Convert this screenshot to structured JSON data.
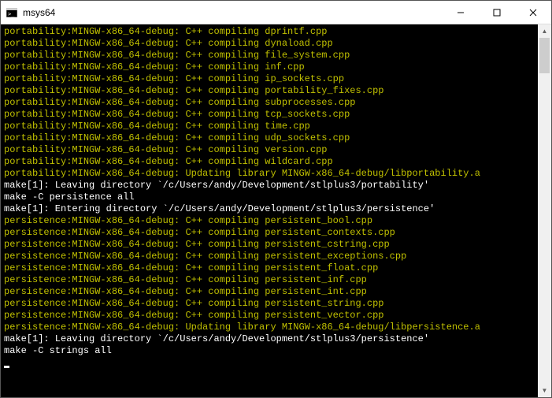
{
  "window": {
    "title": "msys64"
  },
  "lines": [
    {
      "color": "yellow",
      "text": "portability:MINGW-x86_64-debug: C++ compiling dprintf.cpp"
    },
    {
      "color": "yellow",
      "text": "portability:MINGW-x86_64-debug: C++ compiling dynaload.cpp"
    },
    {
      "color": "yellow",
      "text": "portability:MINGW-x86_64-debug: C++ compiling file_system.cpp"
    },
    {
      "color": "yellow",
      "text": "portability:MINGW-x86_64-debug: C++ compiling inf.cpp"
    },
    {
      "color": "yellow",
      "text": "portability:MINGW-x86_64-debug: C++ compiling ip_sockets.cpp"
    },
    {
      "color": "yellow",
      "text": "portability:MINGW-x86_64-debug: C++ compiling portability_fixes.cpp"
    },
    {
      "color": "yellow",
      "text": "portability:MINGW-x86_64-debug: C++ compiling subprocesses.cpp"
    },
    {
      "color": "yellow",
      "text": "portability:MINGW-x86_64-debug: C++ compiling tcp_sockets.cpp"
    },
    {
      "color": "yellow",
      "text": "portability:MINGW-x86_64-debug: C++ compiling time.cpp"
    },
    {
      "color": "yellow",
      "text": "portability:MINGW-x86_64-debug: C++ compiling udp_sockets.cpp"
    },
    {
      "color": "yellow",
      "text": "portability:MINGW-x86_64-debug: C++ compiling version.cpp"
    },
    {
      "color": "yellow",
      "text": "portability:MINGW-x86_64-debug: C++ compiling wildcard.cpp"
    },
    {
      "color": "yellow",
      "text": "portability:MINGW-x86_64-debug: Updating library MINGW-x86_64-debug/libportability.a"
    },
    {
      "color": "white",
      "text": "make[1]: Leaving directory `/c/Users/andy/Development/stlplus3/portability'"
    },
    {
      "color": "white",
      "text": "make -C persistence all"
    },
    {
      "color": "white",
      "text": "make[1]: Entering directory `/c/Users/andy/Development/stlplus3/persistence'"
    },
    {
      "color": "yellow",
      "text": "persistence:MINGW-x86_64-debug: C++ compiling persistent_bool.cpp"
    },
    {
      "color": "yellow",
      "text": "persistence:MINGW-x86_64-debug: C++ compiling persistent_contexts.cpp"
    },
    {
      "color": "yellow",
      "text": "persistence:MINGW-x86_64-debug: C++ compiling persistent_cstring.cpp"
    },
    {
      "color": "yellow",
      "text": "persistence:MINGW-x86_64-debug: C++ compiling persistent_exceptions.cpp"
    },
    {
      "color": "yellow",
      "text": "persistence:MINGW-x86_64-debug: C++ compiling persistent_float.cpp"
    },
    {
      "color": "yellow",
      "text": "persistence:MINGW-x86_64-debug: C++ compiling persistent_inf.cpp"
    },
    {
      "color": "yellow",
      "text": "persistence:MINGW-x86_64-debug: C++ compiling persistent_int.cpp"
    },
    {
      "color": "yellow",
      "text": "persistence:MINGW-x86_64-debug: C++ compiling persistent_string.cpp"
    },
    {
      "color": "yellow",
      "text": "persistence:MINGW-x86_64-debug: C++ compiling persistent_vector.cpp"
    },
    {
      "color": "yellow",
      "text": "persistence:MINGW-x86_64-debug: Updating library MINGW-x86_64-debug/libpersistence.a"
    },
    {
      "color": "white",
      "text": "make[1]: Leaving directory `/c/Users/andy/Development/stlplus3/persistence'"
    },
    {
      "color": "white",
      "text": "make -C strings all"
    }
  ]
}
